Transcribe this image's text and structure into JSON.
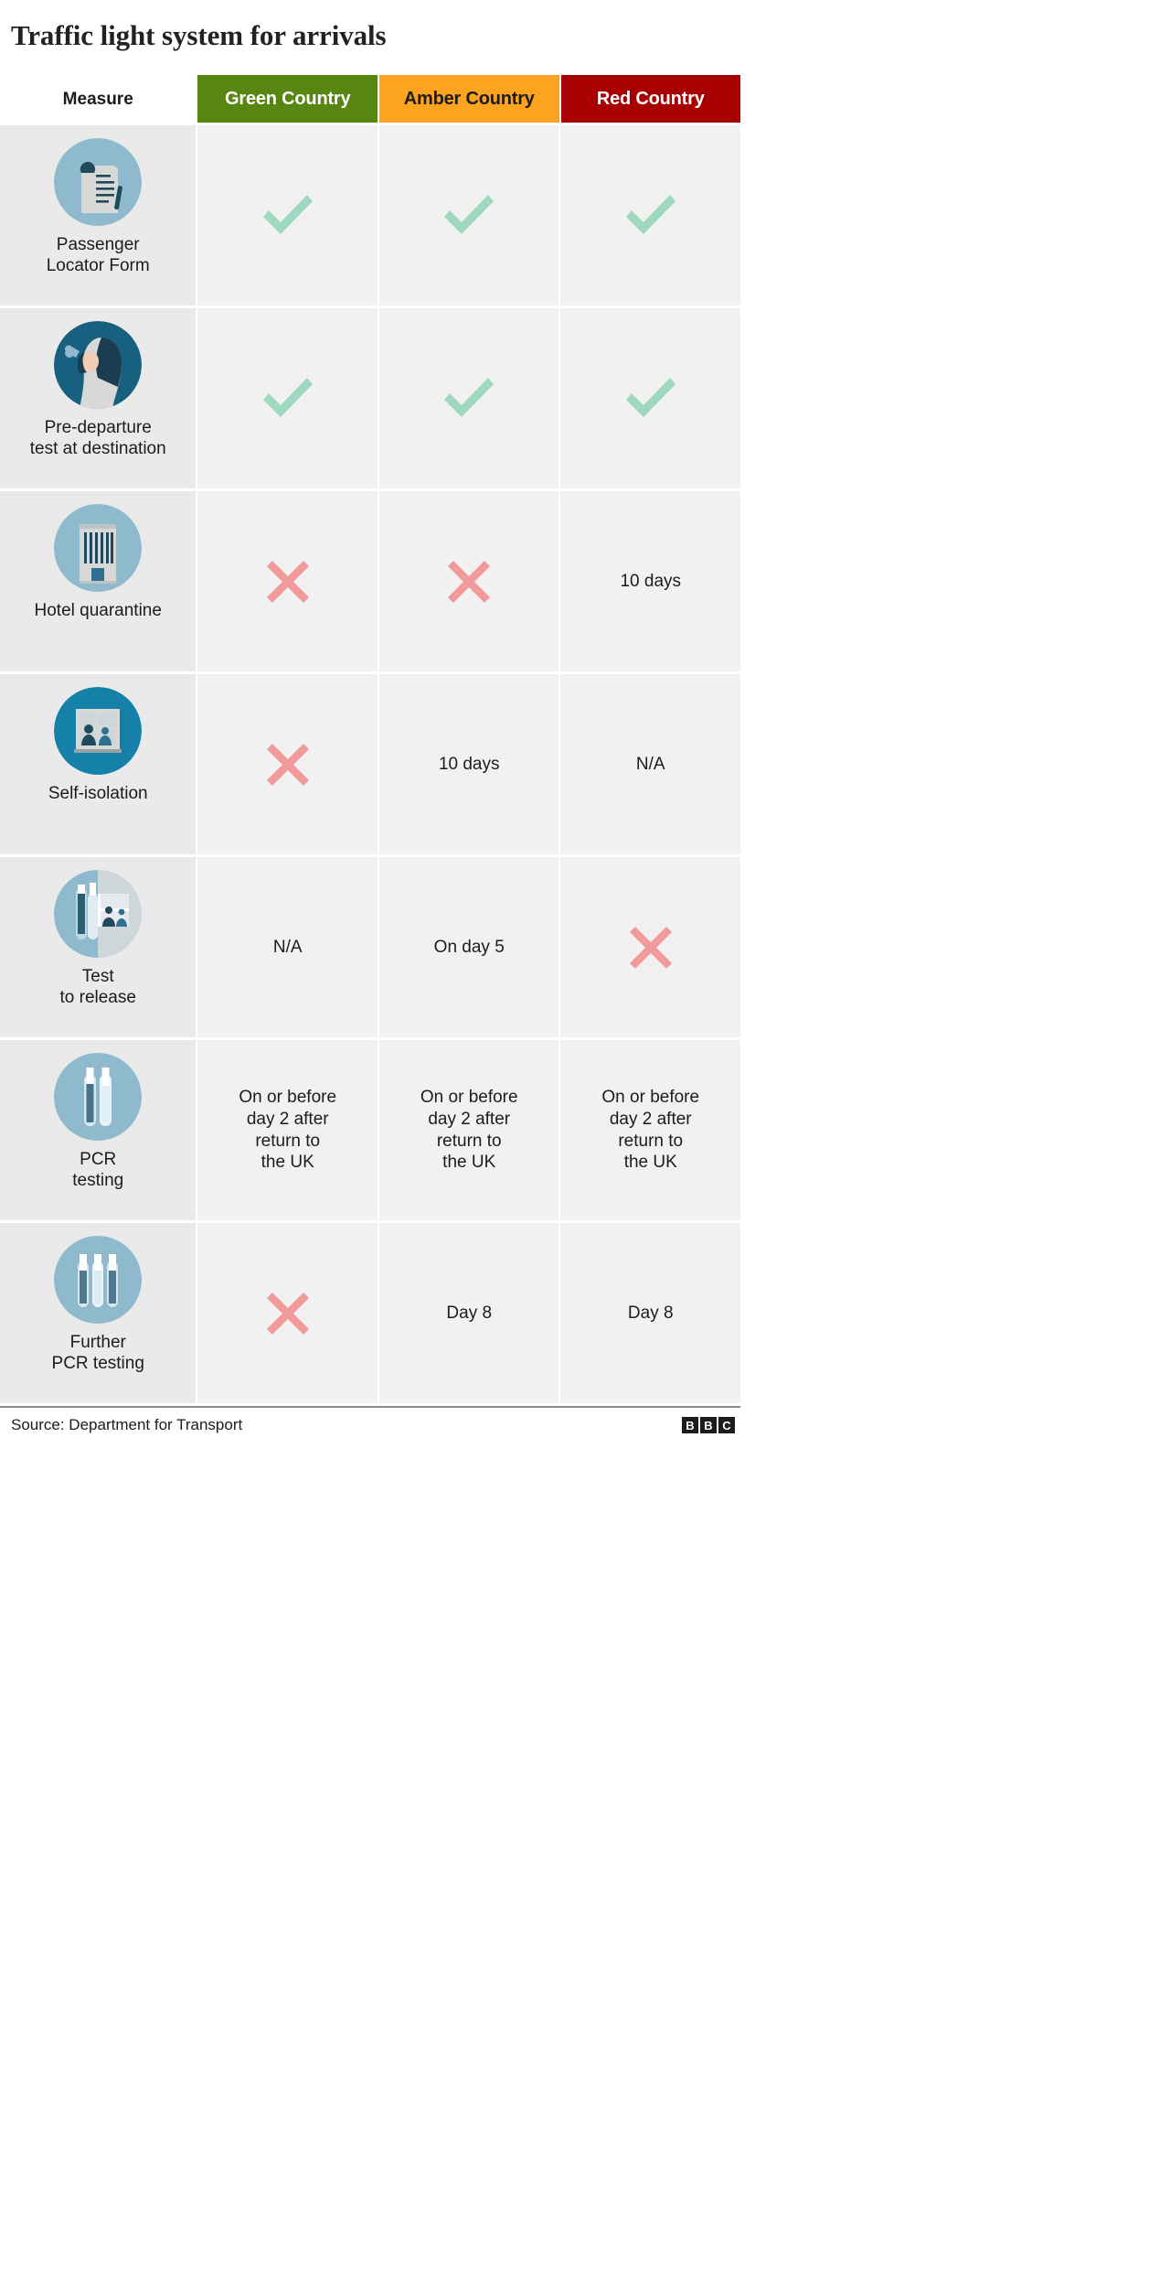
{
  "title": "Traffic light system for arrivals",
  "header": {
    "measure_label": "Measure",
    "columns": [
      {
        "label": "Green Country",
        "bg": "#578611",
        "fg": "#ffffff"
      },
      {
        "label": "Amber Country",
        "bg": "#fca41f",
        "fg": "#1c1c1c"
      },
      {
        "label": "Red Country",
        "bg": "#a80000",
        "fg": "#ffffff"
      }
    ]
  },
  "colors": {
    "tick": "#9ed9bf",
    "cross": "#f09a9a",
    "icon_circle": "#8fb9cc",
    "icon_circle_dark": "#1a7fa8",
    "icon_paper": "#d8d8d6",
    "icon_ink": "#1f4a5c",
    "label_bg": "#eaeaea",
    "cell_bg": "#f1f1f1"
  },
  "rows": [
    {
      "icon": "passenger-locator-form-icon",
      "label": "Passenger\nLocator Form",
      "cells": [
        {
          "type": "tick",
          "text": ""
        },
        {
          "type": "tick",
          "text": ""
        },
        {
          "type": "tick",
          "text": ""
        }
      ]
    },
    {
      "icon": "pre-departure-test-icon",
      "label": "Pre-departure\ntest at destination",
      "cells": [
        {
          "type": "tick",
          "text": ""
        },
        {
          "type": "tick",
          "text": ""
        },
        {
          "type": "tick",
          "text": ""
        }
      ]
    },
    {
      "icon": "hotel-quarantine-icon",
      "label": "Hotel quarantine",
      "cells": [
        {
          "type": "cross",
          "text": ""
        },
        {
          "type": "cross",
          "text": ""
        },
        {
          "type": "text",
          "text": "10 days"
        }
      ]
    },
    {
      "icon": "self-isolation-icon",
      "label": "Self-isolation",
      "cells": [
        {
          "type": "cross",
          "text": ""
        },
        {
          "type": "text",
          "text": "10 days"
        },
        {
          "type": "text",
          "text": "N/A"
        }
      ]
    },
    {
      "icon": "test-to-release-icon",
      "label": "Test\nto release",
      "cells": [
        {
          "type": "text",
          "text": "N/A"
        },
        {
          "type": "text",
          "text": "On day 5"
        },
        {
          "type": "cross",
          "text": ""
        }
      ]
    },
    {
      "icon": "pcr-testing-icon",
      "label": "PCR\ntesting",
      "cells": [
        {
          "type": "text",
          "text": "On or before\nday 2 after\nreturn to\nthe UK"
        },
        {
          "type": "text",
          "text": "On or before\nday 2 after\nreturn to\nthe UK"
        },
        {
          "type": "text",
          "text": "On or before\nday 2 after\nreturn to\nthe UK"
        }
      ]
    },
    {
      "icon": "further-pcr-testing-icon",
      "label": "Further\nPCR testing",
      "cells": [
        {
          "type": "cross",
          "text": ""
        },
        {
          "type": "text",
          "text": "Day 8"
        },
        {
          "type": "text",
          "text": "Day 8"
        }
      ]
    }
  ],
  "footer": {
    "source": "Source: Department for Transport",
    "logo": [
      "B",
      "B",
      "C"
    ]
  }
}
